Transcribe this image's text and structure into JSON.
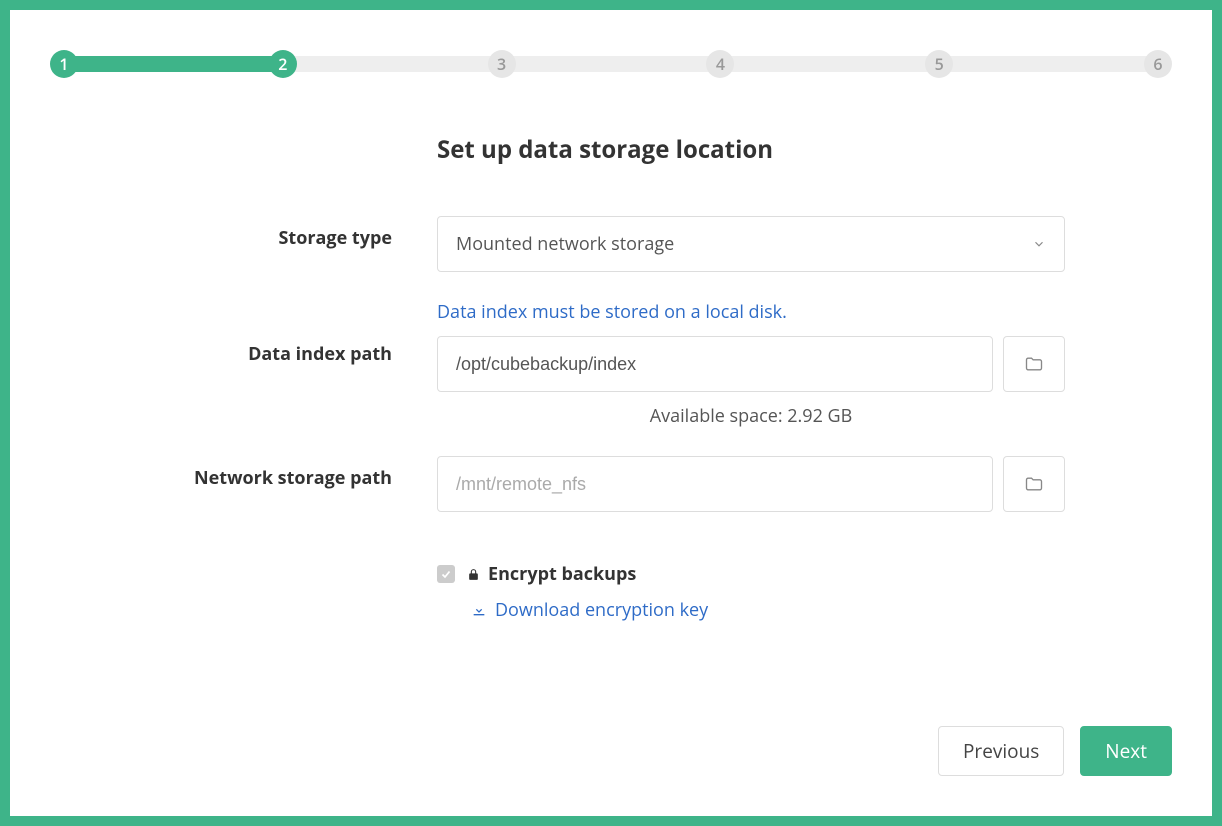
{
  "stepper": {
    "steps": [
      "1",
      "2",
      "3",
      "4",
      "5",
      "6"
    ],
    "current_step": 2,
    "progress_percent": 20
  },
  "title": "Set up data storage location",
  "fields": {
    "storage_type": {
      "label": "Storage type",
      "value": "Mounted network storage"
    },
    "data_index": {
      "label": "Data index path",
      "info": "Data index must be stored on a local disk.",
      "value": "/opt/cubebackup/index",
      "available_space": "Available space: 2.92 GB"
    },
    "network_storage": {
      "label": "Network storage path",
      "placeholder": "/mnt/remote_nfs",
      "value": ""
    }
  },
  "encryption": {
    "checked": true,
    "label": "Encrypt backups",
    "download_link": "Download encryption key"
  },
  "buttons": {
    "previous": "Previous",
    "next": "Next"
  },
  "colors": {
    "primary": "#3eb489",
    "link": "#2e6bc7"
  }
}
